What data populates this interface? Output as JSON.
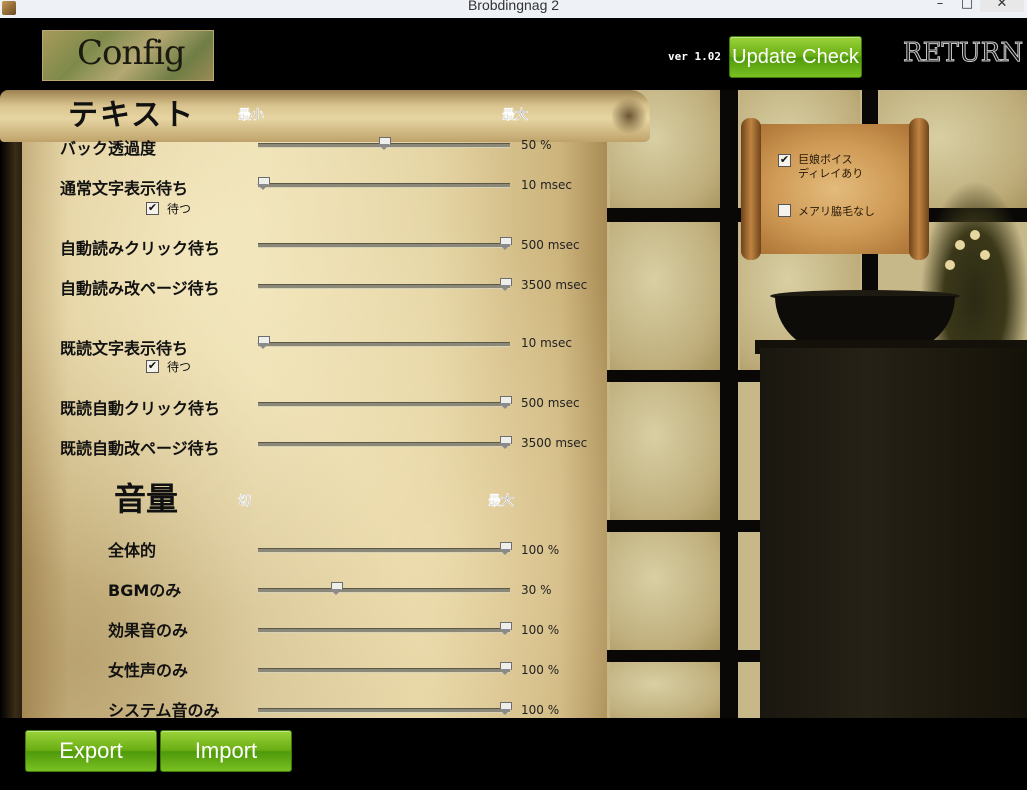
{
  "window": {
    "title": "Brobdingnag 2",
    "minimize": "–",
    "maximize": "□",
    "close": "✕"
  },
  "header": {
    "logo_text": "Config",
    "version": "ver 1.02",
    "update_button": "Update Check",
    "return_label": "RETURN"
  },
  "text_section": {
    "title": "テキスト",
    "min_label": "最小",
    "max_label": "最大",
    "rows": [
      {
        "label": "バック透過度",
        "value": "50 %",
        "level": 0.5
      },
      {
        "label": "通常文字表示待ち",
        "value": "10 msec",
        "level": 0.0
      },
      {
        "label": "自動読みクリック待ち",
        "value": "500 msec",
        "level": 1.0
      },
      {
        "label": "自動読み改ページ待ち",
        "value": "3500 msec",
        "level": 1.0
      },
      {
        "label": "既読文字表示待ち",
        "value": "10 msec",
        "level": 0.0
      },
      {
        "label": "既読自動クリック待ち",
        "value": "500 msec",
        "level": 1.0
      },
      {
        "label": "既読自動改ページ待ち",
        "value": "3500 msec",
        "level": 1.0
      }
    ],
    "wait_checkbox_1": {
      "label": "待つ",
      "checked": true
    },
    "wait_checkbox_2": {
      "label": "待つ",
      "checked": true
    }
  },
  "volume_section": {
    "title": "音量",
    "min_label": "切",
    "max_label": "最大",
    "rows": [
      {
        "label": "全体的",
        "value": "100 %",
        "level": 1.0
      },
      {
        "label": "BGMのみ",
        "value": "30 %",
        "level": 0.3
      },
      {
        "label": "効果音のみ",
        "value": "100 %",
        "level": 1.0
      },
      {
        "label": "女性声のみ",
        "value": "100 %",
        "level": 1.0
      },
      {
        "label": "システム音のみ",
        "value": "100 %",
        "level": 1.0
      }
    ]
  },
  "options_scroll": {
    "option1": {
      "line1": "巨娘ボイス",
      "line2": "ディレイあり",
      "checked": true
    },
    "option2": {
      "label": "メアリ脇毛なし",
      "checked": false
    }
  },
  "footer": {
    "export_button": "Export",
    "import_button": "Import"
  },
  "colors": {
    "button_green": "#6aae14",
    "parchment": "#e2d19f"
  },
  "icons": {
    "checkmark": "✔"
  }
}
